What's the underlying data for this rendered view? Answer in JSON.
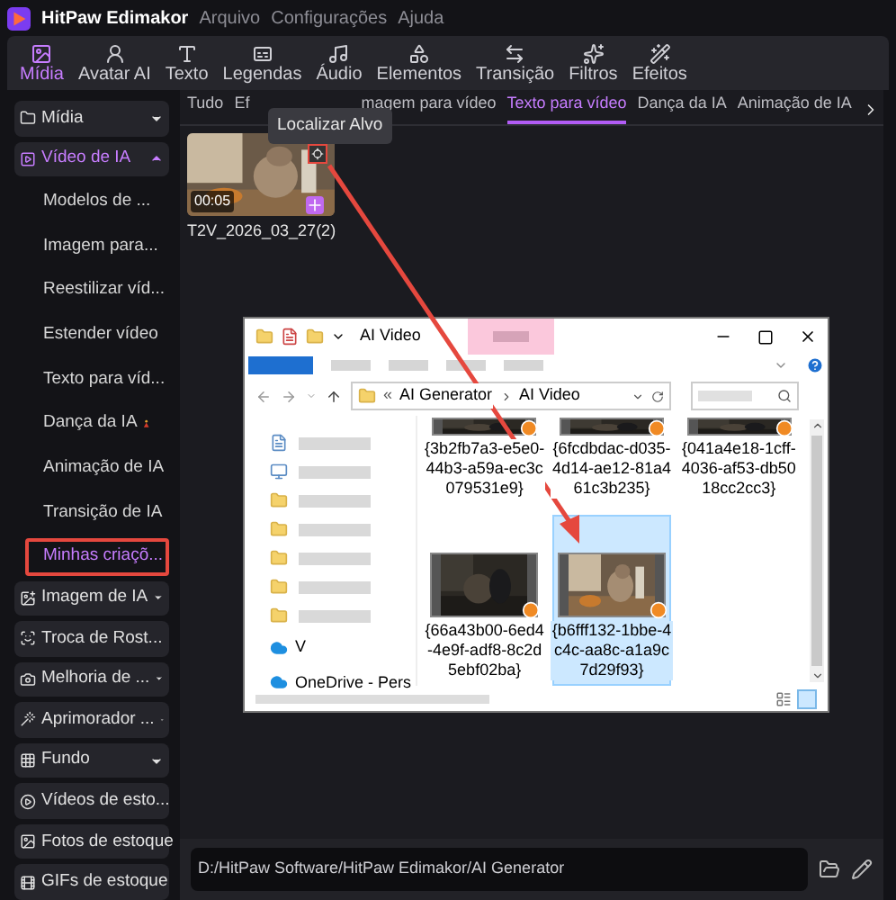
{
  "app": {
    "name": "HitPaw Edimakor",
    "menu": [
      "Arquivo",
      "Configurações",
      "Ajuda"
    ]
  },
  "toolbar": [
    {
      "label": "Mídia",
      "selected": true
    },
    {
      "label": "Avatar AI",
      "selected": false
    },
    {
      "label": "Texto",
      "selected": false
    },
    {
      "label": "Legendas",
      "selected": false
    },
    {
      "label": "Áudio",
      "selected": false
    },
    {
      "label": "Elementos",
      "selected": false
    },
    {
      "label": "Transição",
      "selected": false
    },
    {
      "label": "Filtros",
      "selected": false
    },
    {
      "label": "Efeitos",
      "selected": false
    }
  ],
  "sidebar": [
    {
      "label": "Mídia",
      "expanded": false,
      "selected": false
    },
    {
      "label": "Vídeo de IA",
      "expanded": true,
      "selected": true,
      "children": [
        {
          "label": "Modelos de ...",
          "selected": false,
          "highlighted": false
        },
        {
          "label": "Imagem para...",
          "selected": false,
          "highlighted": false
        },
        {
          "label": "Reestilizar víd...",
          "selected": false,
          "highlighted": false
        },
        {
          "label": "Estender vídeo",
          "selected": false,
          "highlighted": false
        },
        {
          "label": "Texto para víd...",
          "selected": false,
          "highlighted": false
        },
        {
          "label": "Dança da IA",
          "selected": false,
          "highlighted": false,
          "kind": "dance"
        },
        {
          "label": "Animação de IA",
          "selected": false,
          "highlighted": false
        },
        {
          "label": "Transição de IA",
          "selected": false,
          "highlighted": false
        },
        {
          "label": "Minhas criaçõ...",
          "selected": true,
          "highlighted": true
        }
      ]
    },
    {
      "label": "Imagem de IA",
      "expanded": false,
      "selected": false
    },
    {
      "label": "Troca de Rost...",
      "expanded": false,
      "selected": false
    },
    {
      "label": "Melhoria de ...",
      "expanded": false,
      "selected": false
    },
    {
      "label": "Aprimorador ...",
      "expanded": false,
      "selected": false
    },
    {
      "label": "Fundo",
      "expanded": false,
      "selected": false
    },
    {
      "label": "Vídeos de esto...",
      "selected": false
    },
    {
      "label": "Fotos de estoque",
      "selected": false
    },
    {
      "label": "GIFs de estoque",
      "selected": false
    }
  ],
  "tabs": [
    {
      "label": "Tudo",
      "selected": false
    },
    {
      "label": "Ef",
      "selected": false
    },
    {
      "label": "magem para vídeo",
      "selected": false
    },
    {
      "label": "Texto para vídeo",
      "selected": true
    },
    {
      "label": "Dança da IA",
      "selected": false
    },
    {
      "label": "Animação de IA",
      "selected": false
    }
  ],
  "tooltip": "Localizar Alvo",
  "media": [
    {
      "name": "T2V_2026_03_27(2)",
      "duration": "00:05",
      "highlighted": true
    }
  ],
  "path_bar": {
    "value": "D:/HitPaw Software/HitPaw Edimakor/AI Generator"
  },
  "explorer": {
    "title": "AI Video",
    "ribbon": [
      {
        "selected": true
      },
      {
        "selected": false
      },
      {
        "selected": false
      },
      {
        "selected": false
      },
      {
        "selected": false
      }
    ],
    "overflow_mark": "«",
    "breadcrumb": [
      "AI Generator",
      "AI Video"
    ],
    "nav": [
      {
        "label": "V",
        "kind": "cloud"
      },
      {
        "label": "OneDrive - Pers",
        "kind": "cloud"
      }
    ],
    "files": [
      {
        "name": "{3b2fb7a3-e5e0-44b3-a59a-ec3c079531e9}",
        "selected": false,
        "kind": "partial"
      },
      {
        "name": "{6fcdbdac-d035-4d14-ae12-81a461c3b235}",
        "selected": false,
        "kind": "partial"
      },
      {
        "name": "{041a4e18-1cff-4036-af53-db5018cc2cc3}",
        "selected": false,
        "kind": "partial"
      },
      {
        "name": "{66a43b00-6ed4-4e9f-adf8-8c2d5ebf02ba}",
        "selected": false,
        "kind": "full"
      },
      {
        "name": "{b6fff132-1bbe-4c4c-aa8c-a1a9c7d29f93}",
        "selected": true,
        "kind": "full"
      }
    ]
  }
}
